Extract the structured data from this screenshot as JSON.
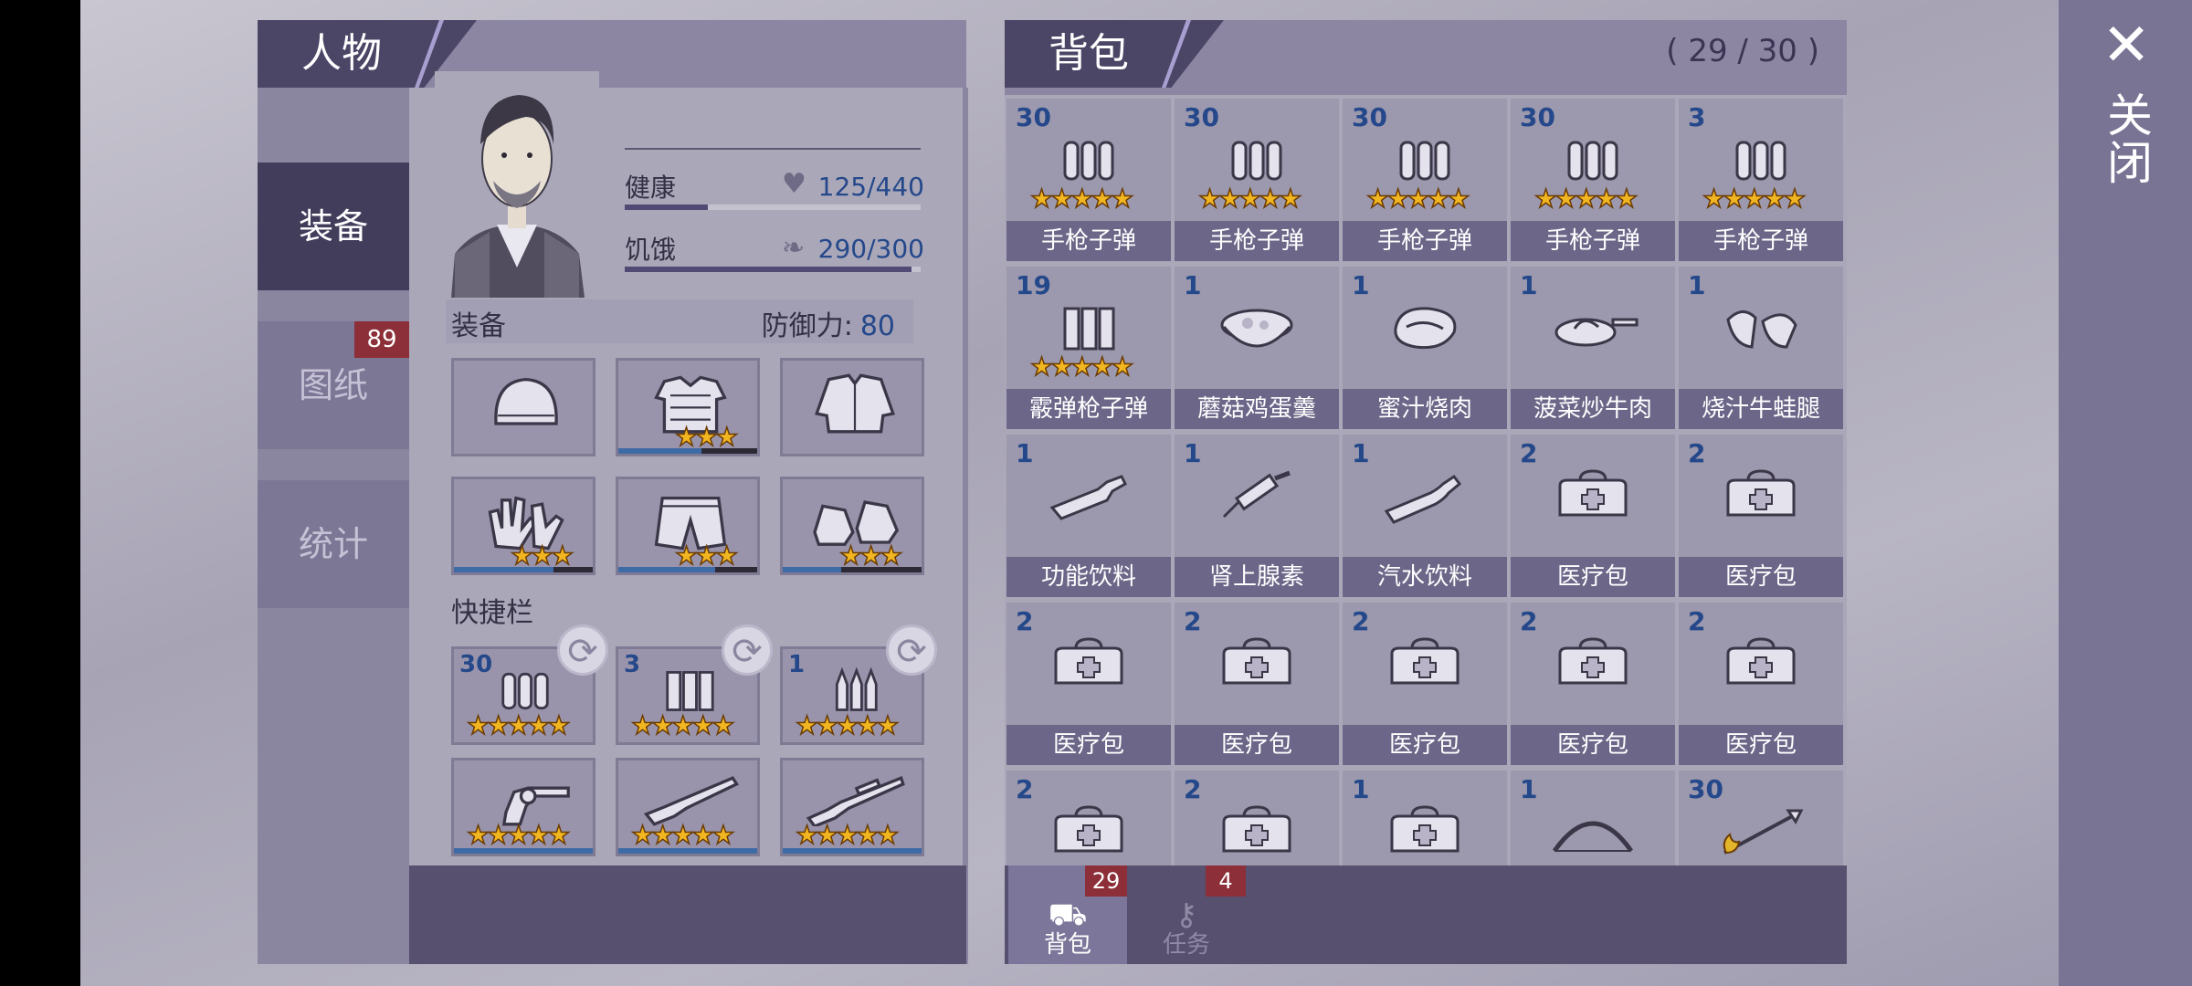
{
  "close": {
    "label": "关闭",
    "icon": "close-icon"
  },
  "character": {
    "title": "人物",
    "side_tabs": [
      {
        "label": "装备",
        "active": true,
        "badge": ""
      },
      {
        "label": "图纸",
        "active": false,
        "badge": "89"
      },
      {
        "label": "统计",
        "active": false,
        "badge": ""
      }
    ],
    "health": {
      "label": "健康",
      "value": "125/440",
      "fraction": 0.28,
      "icon": "heart-icon"
    },
    "hunger": {
      "label": "饥饿",
      "value": "290/300",
      "fraction": 0.97,
      "icon": "stomach-icon"
    },
    "equipment": {
      "label": "装备",
      "defense_label": "防御力:",
      "defense_value": "80",
      "slots": [
        {
          "name": "helmet-slot",
          "icon": "beanie-icon",
          "stars": 0,
          "durability": null
        },
        {
          "name": "armor-slot",
          "icon": "body-armor-icon",
          "stars": 3,
          "durability": 0.6
        },
        {
          "name": "jacket-slot",
          "icon": "jacket-icon",
          "stars": 0,
          "durability": null
        },
        {
          "name": "gloves-slot",
          "icon": "gloves-icon",
          "stars": 3,
          "durability": 0.72
        },
        {
          "name": "pants-slot",
          "icon": "shorts-icon",
          "stars": 3,
          "durability": 0.7
        },
        {
          "name": "boots-slot",
          "icon": "sneakers-icon",
          "stars": 3,
          "durability": 0.42
        }
      ]
    },
    "quickbar": {
      "label": "快捷栏",
      "ammo": [
        {
          "count": "30",
          "icon": "pistol-ammo-icon",
          "stars": 5
        },
        {
          "count": "3",
          "icon": "shotgun-ammo-icon",
          "stars": 5
        },
        {
          "count": "1",
          "icon": "rifle-ammo-icon",
          "stars": 5
        }
      ],
      "weapons": [
        {
          "icon": "revolver-icon",
          "stars": 5,
          "durability": 1.0
        },
        {
          "icon": "shotgun-icon",
          "stars": 5,
          "durability": 1.0
        },
        {
          "icon": "rifle-icon",
          "stars": 5,
          "durability": 1.0
        }
      ]
    }
  },
  "bag": {
    "title": "背包",
    "capacity": "( 29 / 30 )",
    "items": [
      {
        "count": "30",
        "label": "手枪子弹",
        "icon": "pistol-ammo-icon",
        "stars": 5
      },
      {
        "count": "30",
        "label": "手枪子弹",
        "icon": "pistol-ammo-icon",
        "stars": 5
      },
      {
        "count": "30",
        "label": "手枪子弹",
        "icon": "pistol-ammo-icon",
        "stars": 5
      },
      {
        "count": "30",
        "label": "手枪子弹",
        "icon": "pistol-ammo-icon",
        "stars": 5
      },
      {
        "count": "3",
        "label": "手枪子弹",
        "icon": "pistol-ammo-icon",
        "stars": 5
      },
      {
        "count": "19",
        "label": "霰弹枪子弹",
        "icon": "shotgun-ammo-icon",
        "stars": 5
      },
      {
        "count": "1",
        "label": "蘑菇鸡蛋羹",
        "icon": "egg-custard-bowl-icon",
        "stars": 0
      },
      {
        "count": "1",
        "label": "蜜汁烧肉",
        "icon": "roast-meat-icon",
        "stars": 0
      },
      {
        "count": "1",
        "label": "菠菜炒牛肉",
        "icon": "stir-fry-pan-icon",
        "stars": 0
      },
      {
        "count": "1",
        "label": "烧汁牛蛙腿",
        "icon": "frog-legs-icon",
        "stars": 0
      },
      {
        "count": "1",
        "label": "功能饮料",
        "icon": "bottle-icon",
        "stars": 0
      },
      {
        "count": "1",
        "label": "肾上腺素",
        "icon": "syringe-icon",
        "stars": 0
      },
      {
        "count": "1",
        "label": "汽水饮料",
        "icon": "soda-bottle-icon",
        "stars": 0
      },
      {
        "count": "2",
        "label": "医疗包",
        "icon": "medkit-icon",
        "stars": 0
      },
      {
        "count": "2",
        "label": "医疗包",
        "icon": "medkit-icon",
        "stars": 0
      },
      {
        "count": "2",
        "label": "医疗包",
        "icon": "medkit-icon",
        "stars": 0
      },
      {
        "count": "2",
        "label": "医疗包",
        "icon": "medkit-icon",
        "stars": 0
      },
      {
        "count": "2",
        "label": "医疗包",
        "icon": "medkit-icon",
        "stars": 0
      },
      {
        "count": "2",
        "label": "医疗包",
        "icon": "medkit-icon",
        "stars": 0
      },
      {
        "count": "2",
        "label": "医疗包",
        "icon": "medkit-icon",
        "stars": 0
      },
      {
        "count": "2",
        "label": "",
        "icon": "medkit-icon",
        "stars": 0
      },
      {
        "count": "2",
        "label": "",
        "icon": "medkit-icon",
        "stars": 0
      },
      {
        "count": "1",
        "label": "",
        "icon": "medkit-icon",
        "stars": 0
      },
      {
        "count": "1",
        "label": "",
        "icon": "bow-icon",
        "stars": 0
      },
      {
        "count": "30",
        "label": "",
        "icon": "fire-arrow-icon",
        "stars": 0
      }
    ],
    "tabs": [
      {
        "label": "背包",
        "badge": "29",
        "icon": "backpack-icon",
        "active": true
      },
      {
        "label": "任务",
        "badge": "4",
        "icon": "key-icon",
        "active": false
      }
    ]
  }
}
